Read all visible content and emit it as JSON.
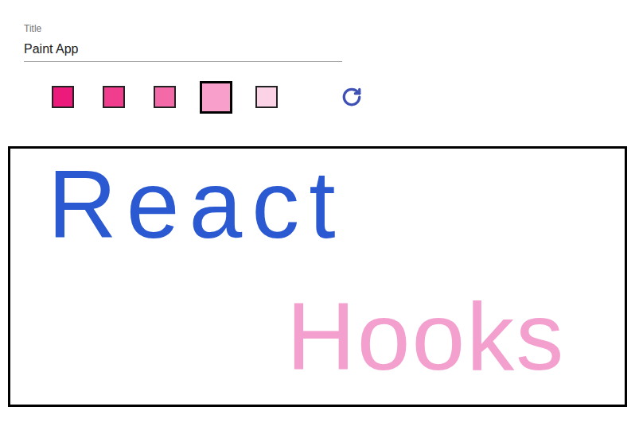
{
  "title_field": {
    "label": "Title",
    "value": "Paint App"
  },
  "swatches": [
    {
      "color": "#ec1a7b",
      "selected": false
    },
    {
      "color": "#f03d8e",
      "selected": false
    },
    {
      "color": "#f46aa8",
      "selected": false
    },
    {
      "color": "#f8a0cb",
      "selected": true
    },
    {
      "color": "#fbd2e6",
      "selected": false
    }
  ],
  "canvas": {
    "drawings": [
      {
        "text": "React",
        "color": "#2b59d1"
      },
      {
        "text": "Hooks",
        "color": "#f4a0cf"
      }
    ]
  }
}
